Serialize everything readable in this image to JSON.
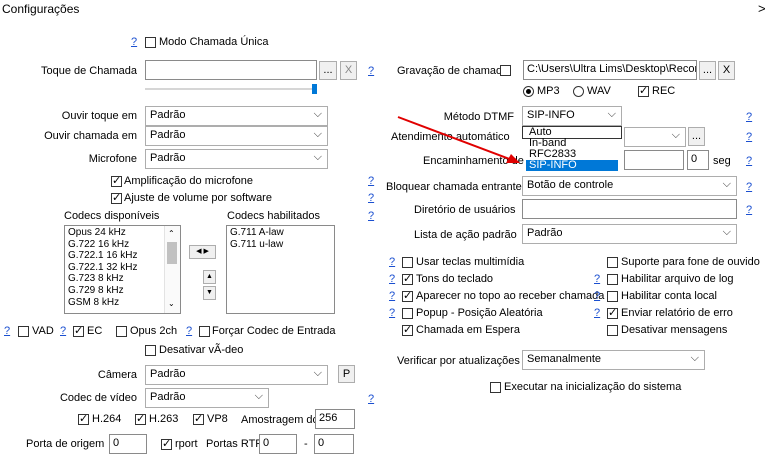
{
  "window": {
    "title": "Configurações",
    "close_label": ">"
  },
  "left": {
    "help_label": "?",
    "single_call_label": "Modo Chamada Única",
    "ringtone_label": "Toque de Chamada",
    "ringtone_value": "",
    "browse_label": "...",
    "clear_label": "X",
    "volume_level": 1.0,
    "hear_ring_label": "Ouvir toque em",
    "hear_ring_value": "Padrão",
    "hear_call_label": "Ouvir chamada em",
    "hear_call_value": "Padrão",
    "mic_label": "Microfone",
    "mic_value": "Padrão",
    "mic_amp_label": "Amplificação do microfone",
    "sw_volume_label": "Ajuste de volume por software",
    "codecs_available_label": "Codecs disponíveis",
    "codecs_enabled_label": "Codecs habilitados",
    "codecs_available": [
      "Opus 24 kHz",
      "G.722 16 kHz",
      "G.722.1 16 kHz",
      "G.722.1 32 kHz",
      "G.723 8 kHz",
      "G.729 8 kHz",
      "GSM 8 kHz"
    ],
    "codecs_enabled": [
      "G.711 A-law",
      "G.711 u-law"
    ],
    "vad_label": "VAD",
    "ec_label": "EC",
    "opus2ch_label": "Opus 2ch",
    "force_codec_label": "Forçar Codec de Entrada",
    "disable_video_label": "Desativar vÃ-deo",
    "camera_label": "Câmera",
    "camera_value": "Padrão",
    "camera_p_label": "P",
    "video_codec_label": "Codec de vídeo",
    "video_codec_value": "Padrão",
    "h264_label": "H.264",
    "h263_label": "H.263",
    "vp8_label": "VP8",
    "sample_label": "Amostragem do",
    "sample_value": "256",
    "source_port_label": "Porta de origem",
    "source_port_value": "0",
    "rport_label": "rport",
    "rtp_ports_label": "Portas RTP",
    "rtp_from": "0",
    "rtp_dash": "-",
    "rtp_to": "0"
  },
  "right": {
    "help_label": "?",
    "recording_label": "Gravação de chamada",
    "recording_path": "C:\\Users\\Ultra Lims\\Desktop\\Recordi",
    "browse_label": "...",
    "clear_label": "X",
    "mp3_label": "MP3",
    "wav_label": "WAV",
    "rec_label": "REC",
    "dtmf_label": "Método DTMF",
    "dtmf_value": "SIP-INFO",
    "dtmf_options": [
      "Auto",
      "In-band",
      "RFC2833",
      "SIP-INFO"
    ],
    "auto_answer_label": "Atendimento automático",
    "forwarding_label": "Encaminhamento de",
    "forwarding_value": "0",
    "seg_label": "seg",
    "block_label": "Bloquear chamada entrante",
    "block_value": "Botão de controle",
    "user_dir_label": "Diretório de usuários",
    "user_dir_value": "",
    "default_action_label": "Lista de ação padrão",
    "default_action_value": "Padrão",
    "multimedia_keys_label": "Usar teclas multimídia",
    "headset_label": "Suporte para fone de ouvido",
    "keypad_tones_label": "Tons do teclado",
    "log_file_label": "Habilitar arquivo de log",
    "on_top_label": "Aparecer no topo ao receber chamada",
    "local_account_label": "Habilitar conta local",
    "popup_label": "Popup - Posição Aleatória",
    "error_report_label": "Enviar relatório de erro",
    "call_waiting_label": "Chamada em Espera",
    "disable_messages_label": "Desativar mensagens",
    "check_updates_label": "Verificar por atualizações",
    "check_updates_value": "Semanalmente",
    "run_startup_label": "Executar na inicialização do sistema"
  },
  "colors": {
    "accent": "#0078d7",
    "help_link": "#1a4fd0",
    "arrow": "#e00000"
  }
}
